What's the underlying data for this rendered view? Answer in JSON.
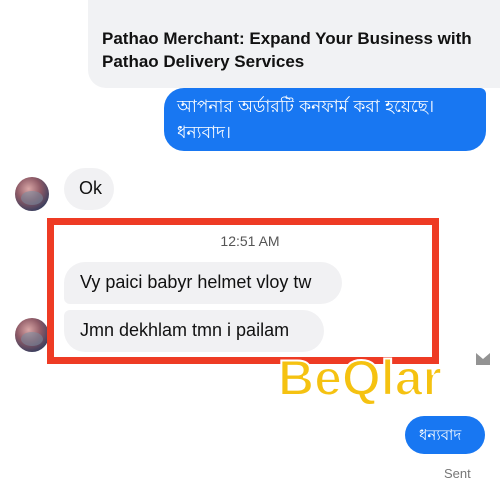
{
  "link_preview": {
    "title": "Pathao Merchant: Expand Your Business with Pathao Delivery Services"
  },
  "messages": {
    "outgoing_confirmation": "আপনার অর্ডারটি কনফার্ম করা হয়েছে। ধন্যবাদ।",
    "incoming_ok": "Ok",
    "timestamp": "12:51 AM",
    "incoming_helmet": "Vy paici babyr helmet vloy tw",
    "incoming_dekhlam": "Jmn dekhlam tmn i pailam",
    "outgoing_thanks": "ধন্যবাদ",
    "status": "Sent"
  },
  "watermark": {
    "text": "BeQlar",
    "color": "#f5c211"
  },
  "colors": {
    "outgoing_bubble": "#1877f2",
    "incoming_bubble": "#f1f1f3",
    "highlight_border": "#ee3b24"
  },
  "icons": {
    "avatar": "contact-avatar",
    "watermark_mark": "watermark-mark-icon"
  }
}
